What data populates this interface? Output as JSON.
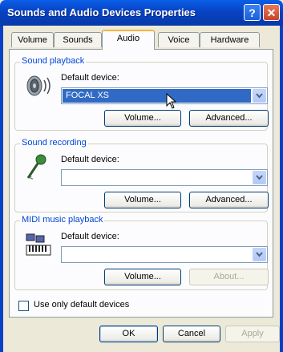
{
  "window": {
    "title": "Sounds and Audio Devices Properties",
    "help_glyph": "?",
    "close_glyph": "✕"
  },
  "tabs": [
    {
      "label": "Volume"
    },
    {
      "label": "Sounds"
    },
    {
      "label": "Audio",
      "active": true
    },
    {
      "label": "Voice"
    },
    {
      "label": "Hardware"
    }
  ],
  "sound_playback": {
    "legend": "Sound playback",
    "default_label": "Default device:",
    "device_value": "FOCAL XS",
    "volume_button": "Volume...",
    "advanced_button": "Advanced..."
  },
  "sound_recording": {
    "legend": "Sound recording",
    "default_label": "Default device:",
    "device_value": "",
    "volume_button": "Volume...",
    "advanced_button": "Advanced..."
  },
  "midi_playback": {
    "legend": "MIDI music playback",
    "default_label": "Default device:",
    "device_value": "",
    "volume_button": "Volume...",
    "about_button": "About..."
  },
  "use_only_default": {
    "label": "Use only default devices",
    "checked": false
  },
  "footer": {
    "ok": "OK",
    "cancel": "Cancel",
    "apply": "Apply"
  },
  "colors": {
    "title_bar": "#0842c4",
    "group_legend": "#0046d5",
    "selection": "#316ac5",
    "active_tab_accent": "#f6b43f"
  }
}
